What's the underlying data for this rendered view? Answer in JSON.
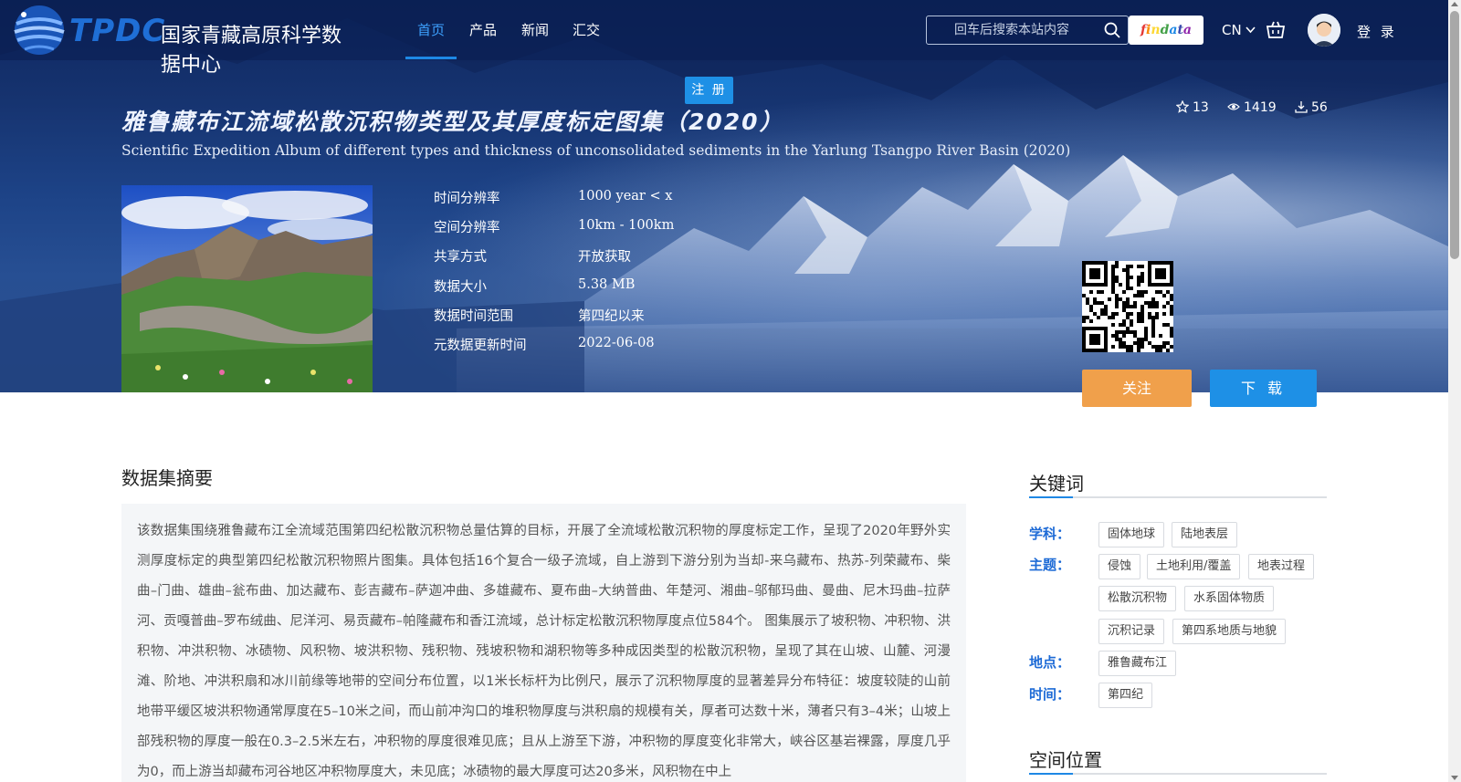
{
  "colors": {
    "accent": "#1e88e5",
    "follow": "#f0a04b",
    "keyword_label": "#1e6bd6",
    "hero": "#1d4387"
  },
  "logo": {
    "short": "TPDC",
    "name": "国家青藏高原科学数据中心"
  },
  "nav": [
    {
      "label": "首页",
      "active": true
    },
    {
      "label": "产品"
    },
    {
      "label": "新闻"
    },
    {
      "label": "汇交"
    }
  ],
  "search": {
    "placeholder": "回车后搜索本站内容",
    "icon": "search-icon"
  },
  "findata": {
    "letters": [
      "f",
      "i",
      "n",
      "d",
      "a",
      "t",
      "a"
    ]
  },
  "lang": "CN",
  "login": "登 录",
  "register": "注 册",
  "dataset": {
    "title_cn": "雅鲁藏布江流域松散沉积物类型及其厚度标定图集（2020）",
    "title_en": "Scientific Expedition Album of different types and thickness of unconsolidated sediments in the Yarlung Tsangpo River Basin (2020)",
    "stats": {
      "stars": "13",
      "views": "1419",
      "downloads": "56"
    },
    "meta": [
      {
        "label": "时间分辨率",
        "value": "1000 year < x"
      },
      {
        "label": "空间分辨率",
        "value": "10km - 100km"
      },
      {
        "label": "共享方式",
        "value": "开放获取"
      },
      {
        "label": "数据大小",
        "value": "5.38 MB"
      },
      {
        "label": "数据时间范围",
        "value": "第四纪以来"
      },
      {
        "label": "元数据更新时间",
        "value": "2022-06-08"
      }
    ],
    "follow": "关注",
    "download": "下 载"
  },
  "abstract": {
    "title": "数据集摘要",
    "text": "该数据集围绕雅鲁藏布江全流域范围第四纪松散沉积物总量估算的目标，开展了全流域松散沉积物的厚度标定工作，呈现了2020年野外实测厚度标定的典型第四纪松散沉积物照片图集。具体包括16个复合一级子流域，自上游到下游分别为当却-来乌藏布、热苏-列荣藏布、柴曲–门曲、雄曲–瓮布曲、加达藏布、彭吉藏布–萨迦冲曲、多雄藏布、夏布曲–大纳普曲、年楚河、湘曲–邬郁玛曲、曼曲、尼木玛曲–拉萨河、贡嘎普曲–罗布绒曲、尼洋河、易贡藏布–帕隆藏布和香江流域，总计标定松散沉积物厚度点位584个。 图集展示了坡积物、冲积物、洪积物、冲洪积物、冰碛物、风积物、坡洪积物、残积物、残坡积物和湖积物等多种成因类型的松散沉积物，呈现了其在山坡、山麓、河漫滩、阶地、冲洪积扇和冰川前缘等地带的空间分布位置，以1米长标杆为比例尺，展示了沉积物厚度的显著差异分布特征：坡度较陡的山前地带平缓区坡洪积物通常厚度在5–10米之间，而山前冲沟口的堆积物厚度与洪积扇的规模有关，厚者可达数十米，薄者只有3–4米；山坡上部残积物的厚度一般在0.3–2.5米左右，冲积物的厚度很难见底；且从上游至下游，冲积物的厚度变化非常大，峡谷区基岩裸露，厚度几乎为0，而上游当却藏布河谷地区冲积物厚度大，未见底；冰碛物的最大厚度可达20多米，风积物在中上"
  },
  "keywords": {
    "title": "关键词",
    "groups": [
      {
        "label": "学科：",
        "tags": [
          "固体地球",
          "陆地表层"
        ]
      },
      {
        "label": "主题：",
        "tags": [
          "侵蚀",
          "土地利用/覆盖",
          "地表过程",
          "松散沉积物",
          "水系固体物质",
          "沉积记录",
          "第四系地质与地貌"
        ]
      },
      {
        "label": "地点：",
        "tags": [
          "雅鲁藏布江"
        ]
      },
      {
        "label": "时间：",
        "tags": [
          "第四纪"
        ]
      }
    ]
  },
  "location": {
    "title": "空间位置"
  }
}
